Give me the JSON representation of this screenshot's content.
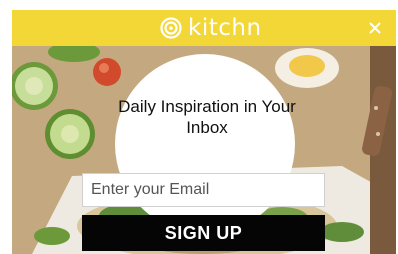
{
  "header": {
    "brand_name": "kitchn",
    "logo_icon": "kitchn-spiral-icon",
    "close_icon": "close-icon",
    "background_color": "#f3d736"
  },
  "main": {
    "headline": "Daily Inspiration in Your Inbox"
  },
  "form": {
    "email_placeholder": "Enter your Email",
    "email_value": "",
    "submit_label": "SIGN UP",
    "button_color": "#050505"
  }
}
